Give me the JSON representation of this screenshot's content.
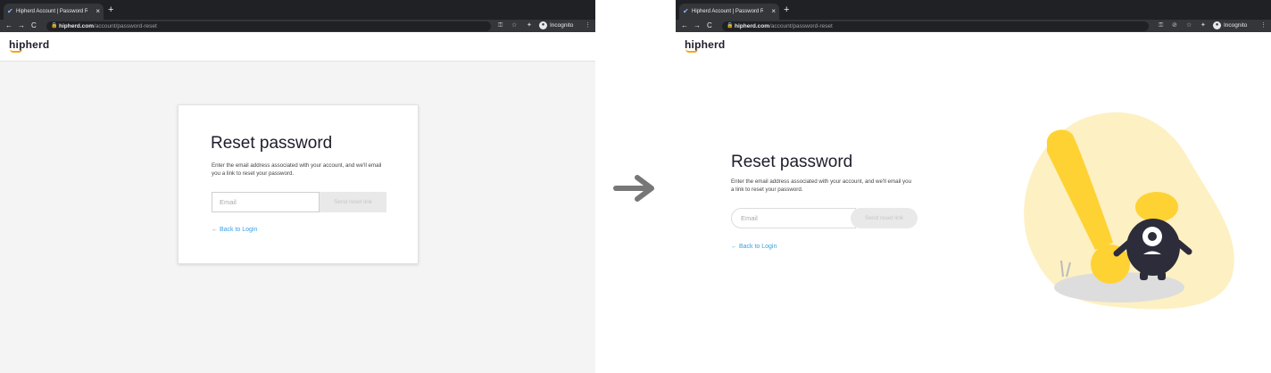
{
  "browser": {
    "tab_title": "Hipherd Account | Password R",
    "tab_close": "×",
    "new_tab": "+",
    "nav_back": "←",
    "nav_forward": "→",
    "nav_reload": "C",
    "url_domain": "hipherd.com",
    "url_path": "/account/password-reset",
    "incognito_label": "Incognito",
    "menu": "⋮"
  },
  "brand": {
    "logo_text": "hipherd",
    "accent_color": "#f6a61a"
  },
  "left": {
    "title": "Reset password",
    "description": "Enter the email address associated with your account, and we'll email you a link to reset your password.",
    "email_placeholder": "Email",
    "send_button": "Send reset link",
    "back_link": "← Back to Login"
  },
  "right": {
    "title": "Reset password",
    "description": "Enter the email address associated with your account, and we'll email you a link to reset your password.",
    "email_placeholder": "Email",
    "send_button": "Send reset link",
    "back_link": "← Back to Login"
  },
  "transition_icon": "right-arrow-icon"
}
